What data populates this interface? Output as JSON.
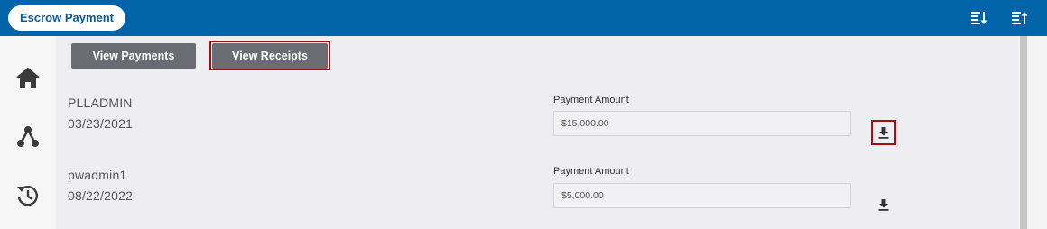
{
  "header": {
    "title": "Escrow Payment",
    "icons": [
      "sort-descending-icon",
      "sort-ascending-icon"
    ]
  },
  "sidebar": {
    "icons": [
      "home-icon",
      "share-network-icon",
      "history-icon"
    ]
  },
  "toolbar": {
    "view_payments_label": "View Payments",
    "view_receipts_label": "View Receipts"
  },
  "payments": [
    {
      "user": "PLLADMIN",
      "date": "03/23/2021",
      "amount_label": "Payment Amount",
      "amount": "$15,000.00"
    },
    {
      "user": "pwadmin1",
      "date": "08/22/2022",
      "amount_label": "Payment Amount",
      "amount": "$5,000.00"
    }
  ],
  "colors": {
    "header_blue": "#0164a8",
    "button_gray": "#6b6b73",
    "focus_red": "#a40f0f",
    "content_bg": "#ededf2"
  }
}
